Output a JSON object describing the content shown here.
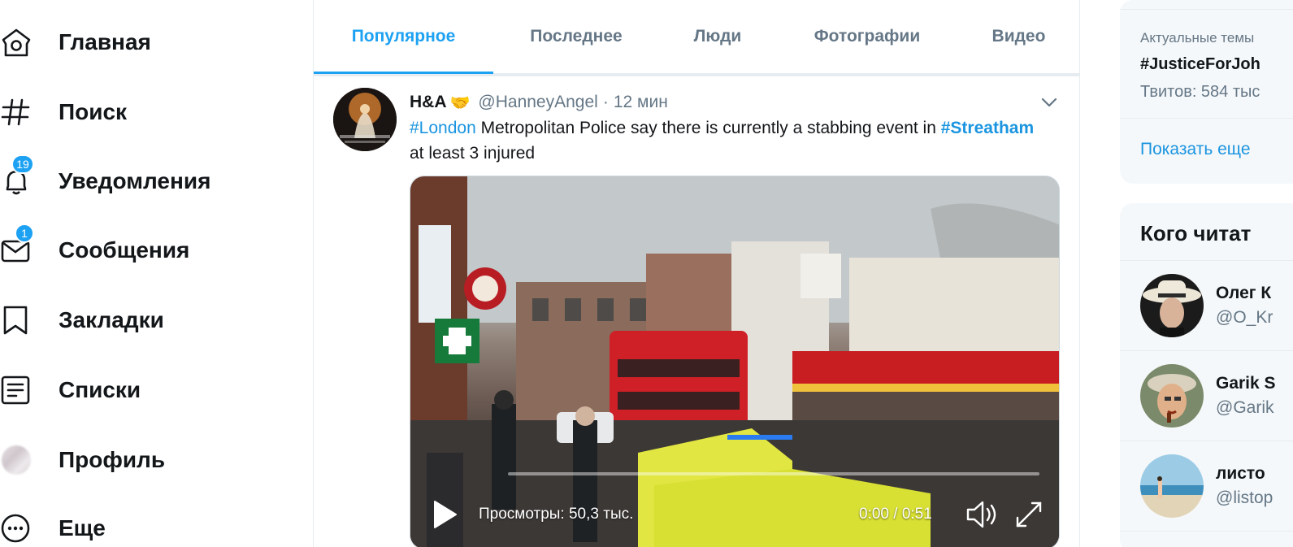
{
  "nav": {
    "items": [
      {
        "label": "Главная",
        "icon": "home-icon"
      },
      {
        "label": "Поиск",
        "icon": "hashtag-icon"
      },
      {
        "label": "Уведомления",
        "icon": "bell-icon",
        "badge": "19"
      },
      {
        "label": "Сообщения",
        "icon": "envelope-icon",
        "badge": "1"
      },
      {
        "label": "Закладки",
        "icon": "bookmark-icon"
      },
      {
        "label": "Списки",
        "icon": "list-icon"
      },
      {
        "label": "Профиль",
        "icon": "avatar"
      },
      {
        "label": "Еще",
        "icon": "more-icon"
      }
    ]
  },
  "search_tabs": {
    "items": [
      {
        "label": "Популярное",
        "active": true
      },
      {
        "label": "Последнее"
      },
      {
        "label": "Люди"
      },
      {
        "label": "Фотографии"
      },
      {
        "label": "Видео"
      }
    ]
  },
  "tweet": {
    "author_name": "H&A",
    "author_emoji": "🤝",
    "handle": "@HanneyAngel",
    "separator": "·",
    "time": "12 мин",
    "text": {
      "hashtag1": "#London",
      "part1": " Metropolitan Police say there is currently a stabbing event in ",
      "hashtag2": "#Streatham",
      "part2": " at least 3 injured"
    },
    "video": {
      "views": "Просмотры: 50,3 тыс.",
      "time": "0:00 / 0:51",
      "progress": 0.0
    }
  },
  "sidebar": {
    "trends": {
      "meta": "Актуальные темы",
      "name": "#JusticeForJoh",
      "count": "Твитов: 584 тыс",
      "show_more": "Показать еще"
    },
    "who_to_follow": {
      "title": "Кого читат",
      "items": [
        {
          "name": "Олег К",
          "handle": "@O_Kr"
        },
        {
          "name": "Garik S",
          "handle": "@Garik"
        },
        {
          "name": "листо",
          "handle": "@listop"
        }
      ]
    }
  },
  "colors": {
    "accent": "#1da1f2",
    "link": "#1b95e0",
    "text": "#14171a",
    "secondary": "#657786",
    "border": "#e6ecf0",
    "panel_bg": "#f5f8fa"
  }
}
